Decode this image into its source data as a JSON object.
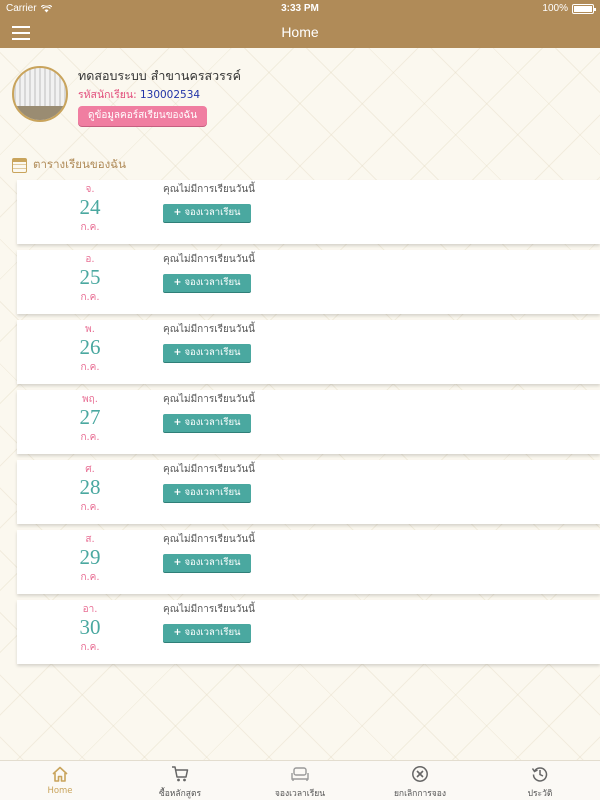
{
  "status_bar": {
    "carrier": "Carrier",
    "time": "3:33 PM",
    "battery": "100%"
  },
  "nav": {
    "title": "Home"
  },
  "profile": {
    "name": "ทดสอบระบบ สำขานครสวรรค์",
    "student_id_label": "รหัสนักเรียน:",
    "student_id": "130002534",
    "course_button": "ดูข้อมูลคอร์สเรียนของฉัน"
  },
  "schedule": {
    "title": "ตารางเรียนของฉัน",
    "days": [
      {
        "weekday": "จ.",
        "day": "24",
        "month": "ก.ค.",
        "message": "คุณไม่มีการเรียนวันนี้",
        "button": "จองเวลาเรียน"
      },
      {
        "weekday": "อ.",
        "day": "25",
        "month": "ก.ค.",
        "message": "คุณไม่มีการเรียนวันนี้",
        "button": "จองเวลาเรียน"
      },
      {
        "weekday": "พ.",
        "day": "26",
        "month": "ก.ค.",
        "message": "คุณไม่มีการเรียนวันนี้",
        "button": "จองเวลาเรียน"
      },
      {
        "weekday": "พฤ.",
        "day": "27",
        "month": "ก.ค.",
        "message": "คุณไม่มีการเรียนวันนี้",
        "button": "จองเวลาเรียน"
      },
      {
        "weekday": "ศ.",
        "day": "28",
        "month": "ก.ค.",
        "message": "คุณไม่มีการเรียนวันนี้",
        "button": "จองเวลาเรียน"
      },
      {
        "weekday": "ส.",
        "day": "29",
        "month": "ก.ค.",
        "message": "คุณไม่มีการเรียนวันนี้",
        "button": "จองเวลาเรียน"
      },
      {
        "weekday": "อา.",
        "day": "30",
        "month": "ก.ค.",
        "message": "คุณไม่มีการเรียนวันนี้",
        "button": "จองเวลาเรียน"
      }
    ]
  },
  "tabs": [
    {
      "label": "Home",
      "icon": "home-icon",
      "active": true
    },
    {
      "label": "ซื้อหลักสูตร",
      "icon": "cart-icon",
      "active": false
    },
    {
      "label": "จองเวลาเรียน",
      "icon": "sofa-icon",
      "active": false
    },
    {
      "label": "ยกเลิกการจอง",
      "icon": "cancel-icon",
      "active": false
    },
    {
      "label": "ประวัติ",
      "icon": "history-icon",
      "active": false
    }
  ],
  "colors": {
    "header": "#b08b58",
    "accent_gold": "#c9a45c",
    "pink": "#f07ea1",
    "teal": "#4aa8a0",
    "student_id_blue": "#2234a8"
  }
}
